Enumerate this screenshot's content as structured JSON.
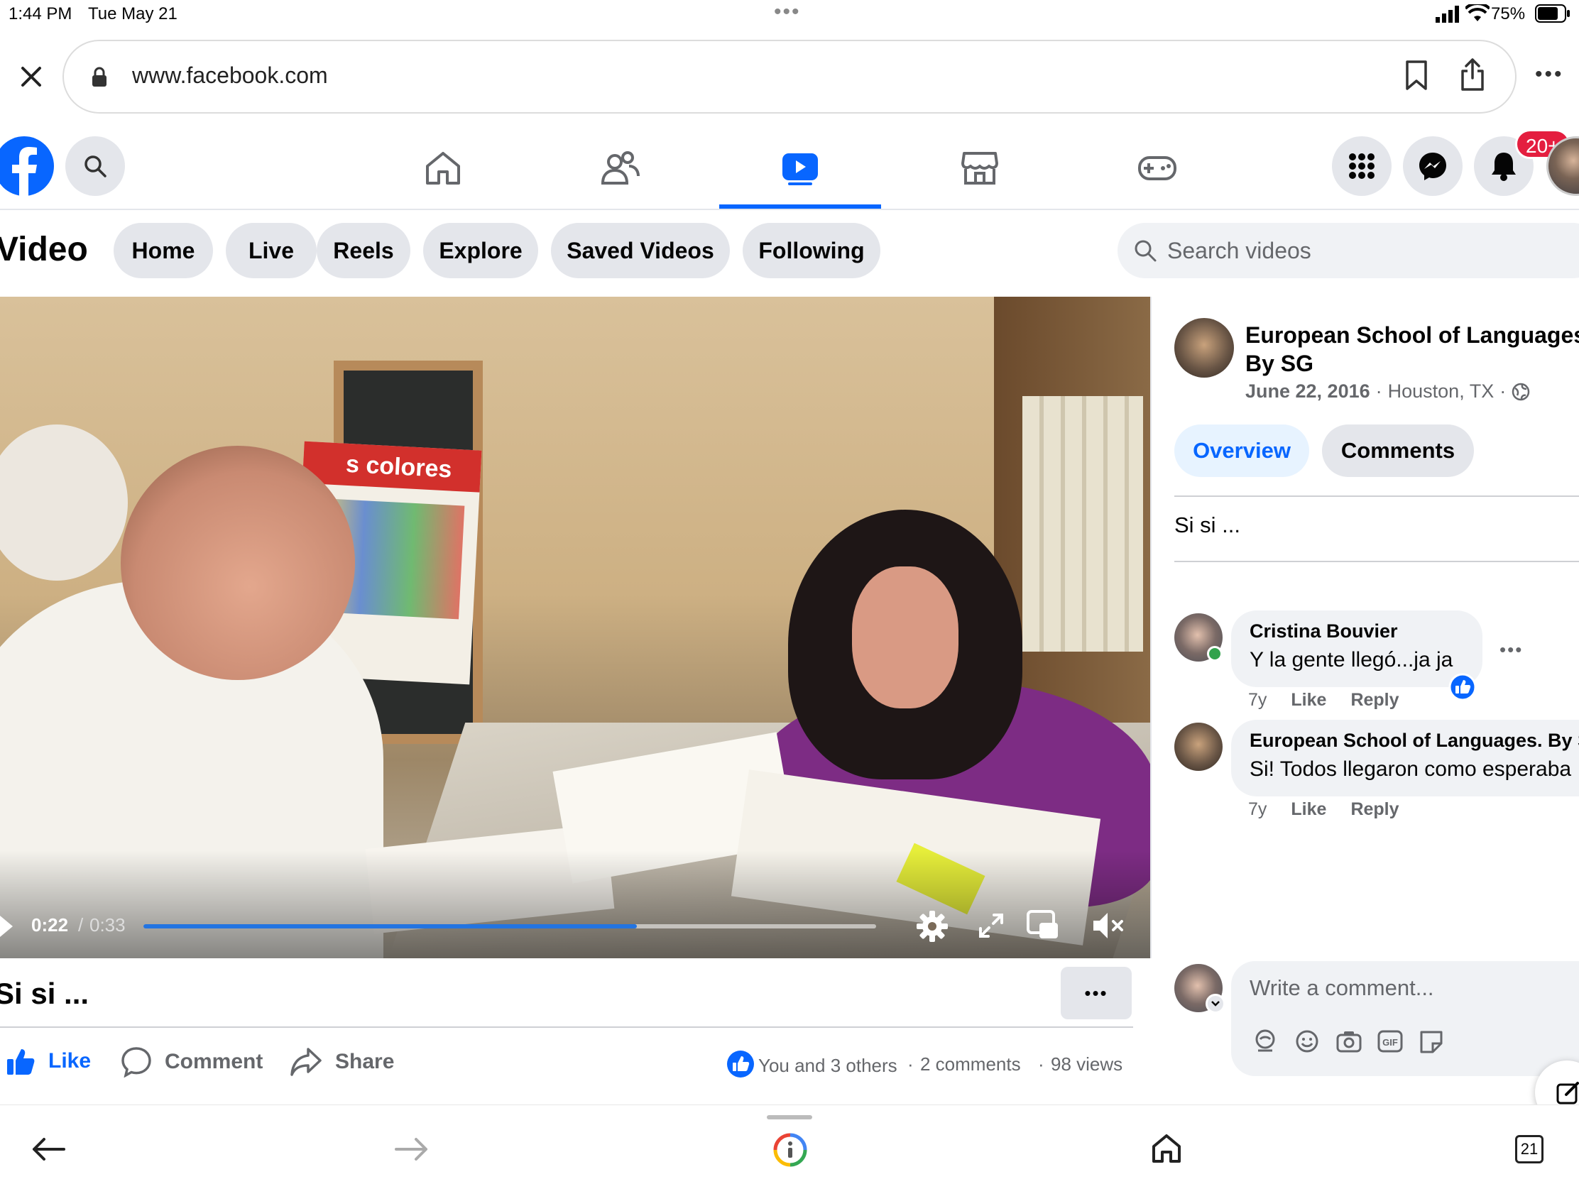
{
  "status_bar": {
    "time": "1:44 PM",
    "date": "Tue May 21",
    "battery": "75%"
  },
  "browser": {
    "url": "www.facebook.com"
  },
  "notifications": {
    "badge": "20+"
  },
  "video_nav": {
    "title": "Video",
    "pills": [
      "Home",
      "Live",
      "Reels",
      "Explore",
      "Saved Videos",
      "Following"
    ],
    "search_placeholder": "Search videos"
  },
  "video": {
    "current_time": "0:22",
    "duration": "0:33",
    "progress": 0.6732,
    "title": "Si si ...",
    "poster_text": "s colores"
  },
  "actions": {
    "like": "Like",
    "comment": "Comment",
    "share": "Share",
    "reactions_text": "You and 3 others",
    "comments_count": "2 comments",
    "views": "98 views"
  },
  "post": {
    "page_name_line1": "European School of Languages.",
    "page_name_line2": "By SG",
    "date": "June 22, 2016",
    "location": "Houston, TX",
    "tabs": [
      "Overview",
      "Comments"
    ],
    "description": "Si si ..."
  },
  "comments": [
    {
      "author": "Cristina Bouvier",
      "text": "Y la gente llegó...ja ja",
      "age": "7y",
      "like": "Like",
      "reply": "Reply"
    },
    {
      "author": "European School of Languages. By SG",
      "text": "Si! Todos llegaron como esperaba",
      "age": "7y",
      "like": "Like",
      "reply": "Reply"
    }
  ],
  "composer": {
    "placeholder": "Write a comment..."
  },
  "tabs_count": "21",
  "colors": {
    "fb_blue": "#0866ff",
    "accent_blue": "#1877f2",
    "badge_red": "#e41e3f",
    "gray_bg": "#e4e6eb"
  }
}
